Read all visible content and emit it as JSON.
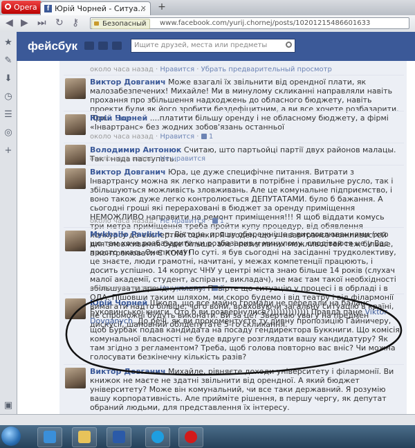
{
  "browser": {
    "menu_label": "Opera",
    "tab_title": "Юрій Чорней - Ситуа...",
    "security_label": "Безопасный",
    "url": "www.facebook.com/yurij.chornej/posts/10201215486601633"
  },
  "facebook": {
    "logo": "фейсбук",
    "search_placeholder": "Ищите друзей, места или предметы"
  },
  "meta_common": {
    "time": "около часа назад",
    "like": "Нравится",
    "unlike": "Не нравится"
  },
  "comments": [
    {
      "meta_extra": "Убрать предварительный просмотр"
    },
    {
      "author": "Виктор Довганич",
      "text": "Може взагалі їх звільнити від орендної плати, як малозабезпечених! Михайле! Ми в минулому скликанні направляли навіть прохання про збільшення надходжень до обласного бюджету, навіть проекти були як його зробити бездефіцитним, а ви все хочете розбазарити. При...",
      "more": "Еще"
    },
    {
      "author": "Юрій Чорней",
      "text": "....платити більшу оренду і не обласному бюджету, а фірмі «Інвартранс» без жодних зобов'язань останньої",
      "likes": "1"
    },
    {
      "author": "Володимир Антонюк",
      "text": "Считаю, што партьойці партії двух районов малацы. Так і нада паступать."
    },
    {
      "author": "Виктор Довганич",
      "text": "Юра, це дуже специфічне питання. Витрати з Інвартрансу можна як легко направити в потрібне і правильне русло, так і збільшуються можливість зловживань. Але це комунальне підприємство, і воно також дуже легко контролюється ДЕПУТАТАМИ. було б бажання. А сьогодні гроші які перераховані в бюджет за оренду приміщення НЕМОЖЛИВО направити на ремонт приміщення!!! Я щоб віддати комусь три метра приміщення треба пройти купу процедур, від обявлення конкурсу до експертної оцінки. Я згоден, що у Інвартранса можливостей для зловживання буде більше, але і позитивних можливостей теж більше, а контролювати Є КОМУ!",
      "likes": "1"
    },
    {
      "author": "Mykhailo Pavliuk",
      "text": "п. Вікторе, прошу обережніше з висловлюваннями (хто що там хоче розбазарити чи розбазарив у минулому, сподіваюся це у Вас просто якась Очепятка) По суті. я був сьогодні на засіданні трудколективу, це знаєте, люди грамотні, начитані, у межах компетенції працюють, і досить успішно. 14 корпус ЧНУ у центрі міста знаю більше 14 років (слухач малої академії, студент, аспірант, викладач), не має там такої необхідності збільшувати арендну плану. Повірте що ситуацію у процесі і в обрладі і в ОДА. Пішовши таким шляхом, ми скоро будемо і від театру і від філармонії вимагати надто більше, чого вони, враховуючи загальну ситуацію в країні, не спроможні будуть виконати. Ви за це? Звертаю увагу на предмен дискусії, шановний облдепутате 5-го скликання.",
      "likes": "1"
    },
    {
      "author": "Юрій Чорней",
      "text_a": "Шкода, що все майно громади не передали на баланс Буковинської книги. Ото б ви розвернулися?))))))))))))) Правда пане ",
      "mention": "Viktor Dovganych",
      "text_b": ". До речі, як ви прокоментуєте ту дивну пропозицію Гайничеру, щоб Бурбак подав кандидата на посаду гендиректора Буккниги. Що комісія комунальної власності не буде вдруге розглядати вашу кандидатуру? Як там згідно з регламентом? Треба, щоб голова повторно вас вніс? Чи можна голосувати безкінечну кількість разів?"
    },
    {
      "author": "Виктор Довганич",
      "text": "Михайле, рівняєте доходи університету і філармонії. Ви книжок не маєте не здатні звільнити від орендної. А який бюджет університету? Може він комунальний, чи все таки державний. Я розумію вашу корпоративність. Але прийміте рішення, в першу чергу, як депутат обраний людьми, для представлення їх інтересу."
    }
  ]
}
